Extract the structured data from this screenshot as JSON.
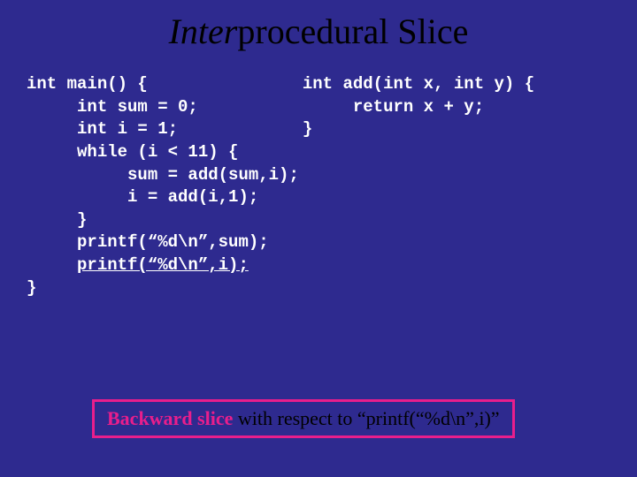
{
  "title": {
    "emph": "Inter",
    "rest": "procedural Slice"
  },
  "code": {
    "left": "int main() {\n     int sum = 0;\n     int i = 1;\n     while (i < 11) {\n          sum = add(sum,i);\n          i = add(i,1);\n     }\n     printf(“%d\\n”,sum);\n     ",
    "left_criterion": "printf(“%d\\n”,i);",
    "left_tail": "\n}",
    "right": "int add(int x, int y) {\n     return x + y;\n}"
  },
  "caption": {
    "lead": "Backward slice",
    "rest": " with respect to “printf(“%d\\n”,i)”"
  }
}
